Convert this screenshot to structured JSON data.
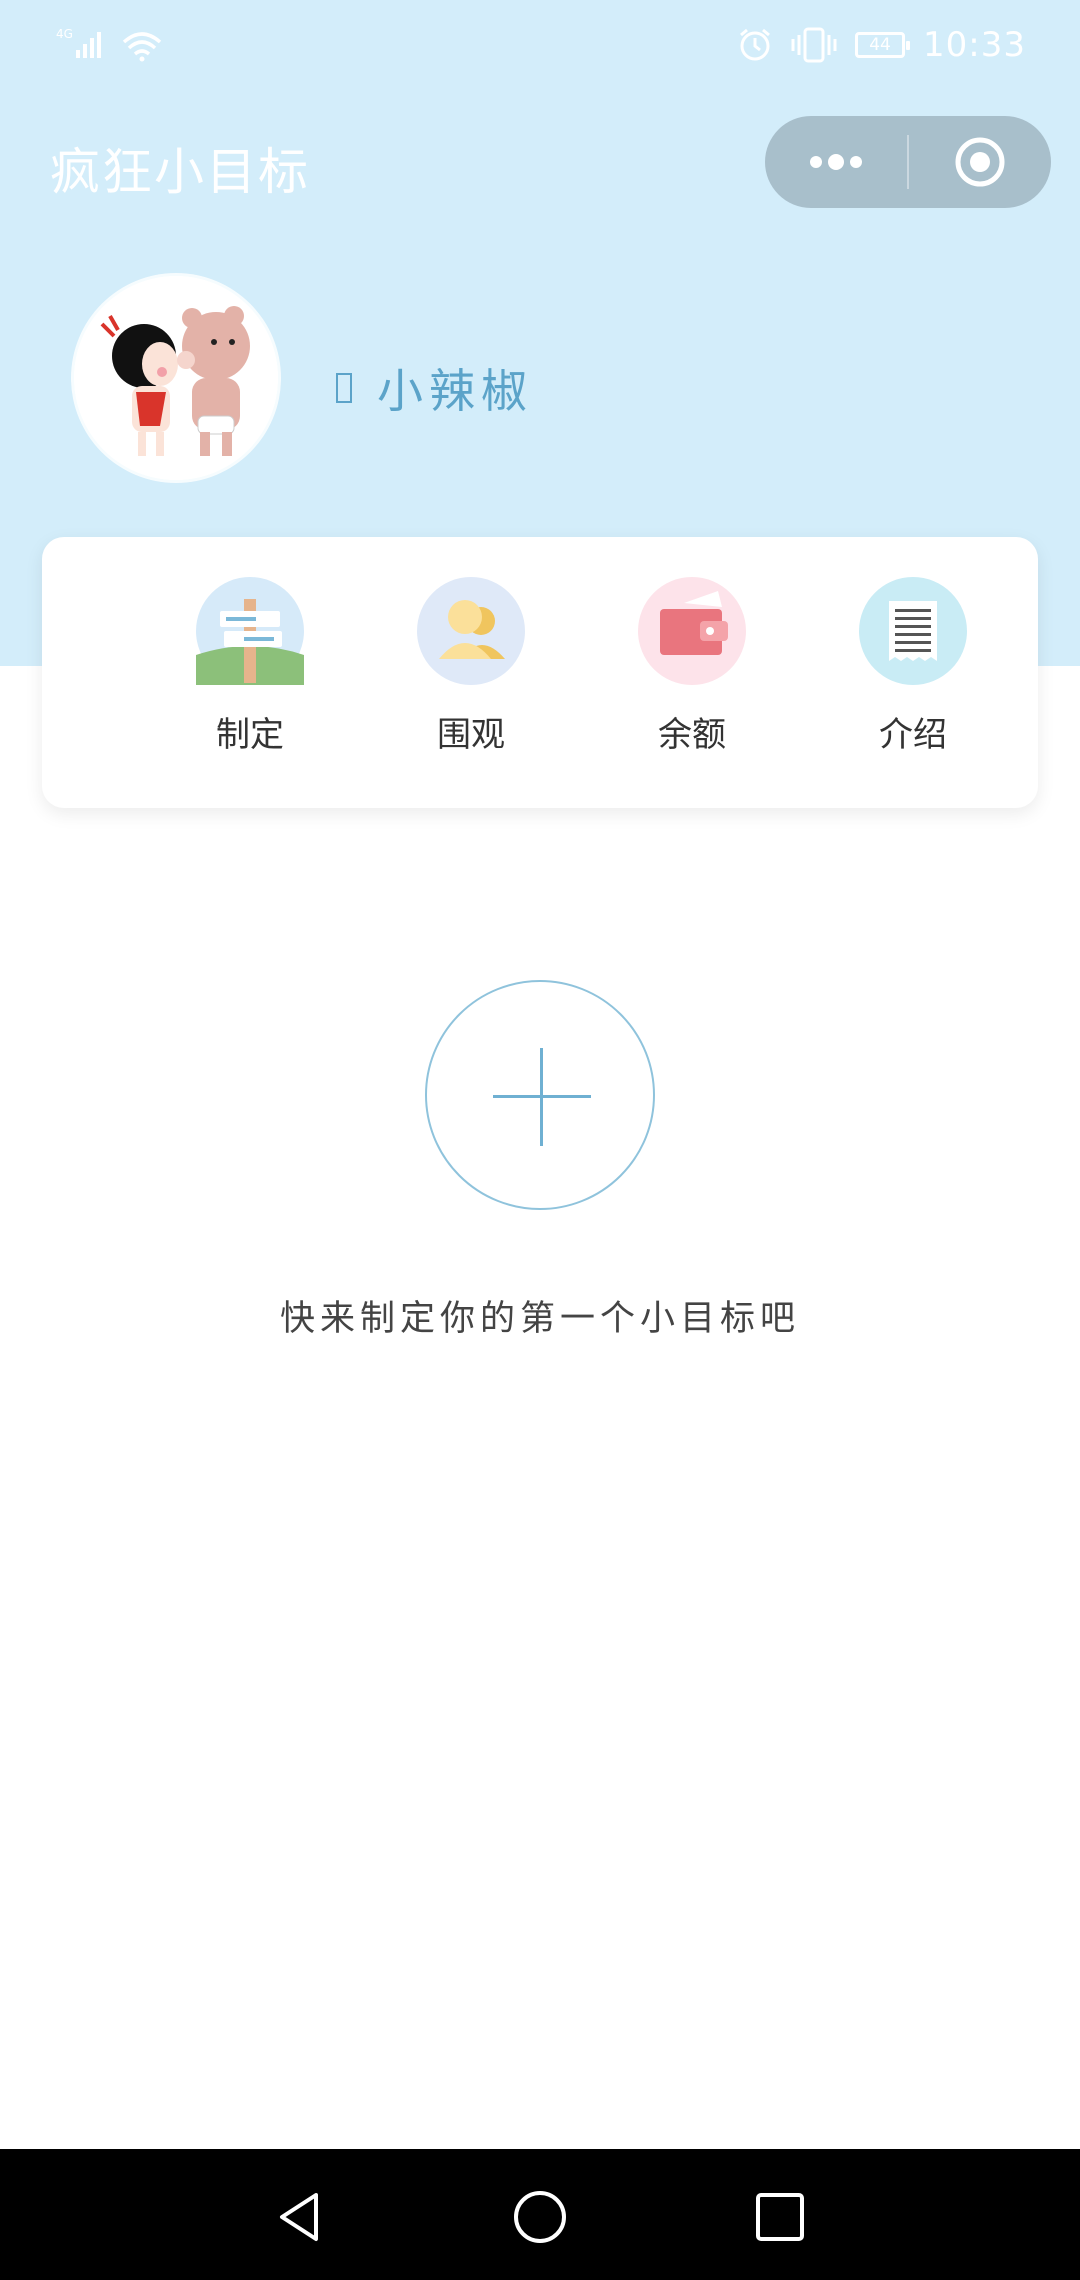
{
  "status_bar": {
    "network": "4G",
    "battery": "44",
    "time": "10:33"
  },
  "header": {
    "title": "疯狂小目标"
  },
  "profile": {
    "username": "小辣椒"
  },
  "menu": {
    "items": [
      {
        "label": "制定",
        "icon": "signpost-icon",
        "color": "#d6eaf9"
      },
      {
        "label": "围观",
        "icon": "users-icon",
        "color": "#dfe9f8"
      },
      {
        "label": "余额",
        "icon": "wallet-icon",
        "color": "#fde3ea"
      },
      {
        "label": "介绍",
        "icon": "document-icon",
        "color": "#c9ecf5"
      }
    ]
  },
  "empty_state": {
    "message": "快来制定你的第一个小目标吧"
  },
  "colors": {
    "header_bg": "#d3edfa",
    "accent": "#5ba3c9"
  }
}
